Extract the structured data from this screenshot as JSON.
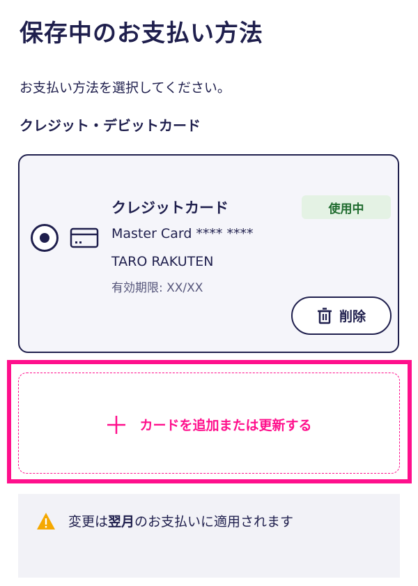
{
  "page": {
    "title": "保存中のお支払い方法",
    "instruction": "お支払い方法を選択してください。",
    "section_heading": "クレジット・デビットカード"
  },
  "saved_card": {
    "selected": true,
    "name": "クレジットカード",
    "brand_masked": "Master Card **** ****",
    "holder": "TARO RAKUTEN",
    "expiry": "有効期限: XX/XX",
    "status_badge": "使用中",
    "delete_label": "削除",
    "icon": "credit-card-icon"
  },
  "add_card": {
    "label": "カードを追加または更新する",
    "icon": "plus-icon"
  },
  "notice": {
    "icon": "warning-icon",
    "text_before": "変更は",
    "text_bold": "翌月",
    "text_after": "のお支払いに適用されます"
  },
  "colors": {
    "primary": "#1f1f4d",
    "accent": "#ff0f8c",
    "badge_bg": "#e4f2e4",
    "badge_text": "#1f6b2e",
    "warning": "#f5a800"
  }
}
